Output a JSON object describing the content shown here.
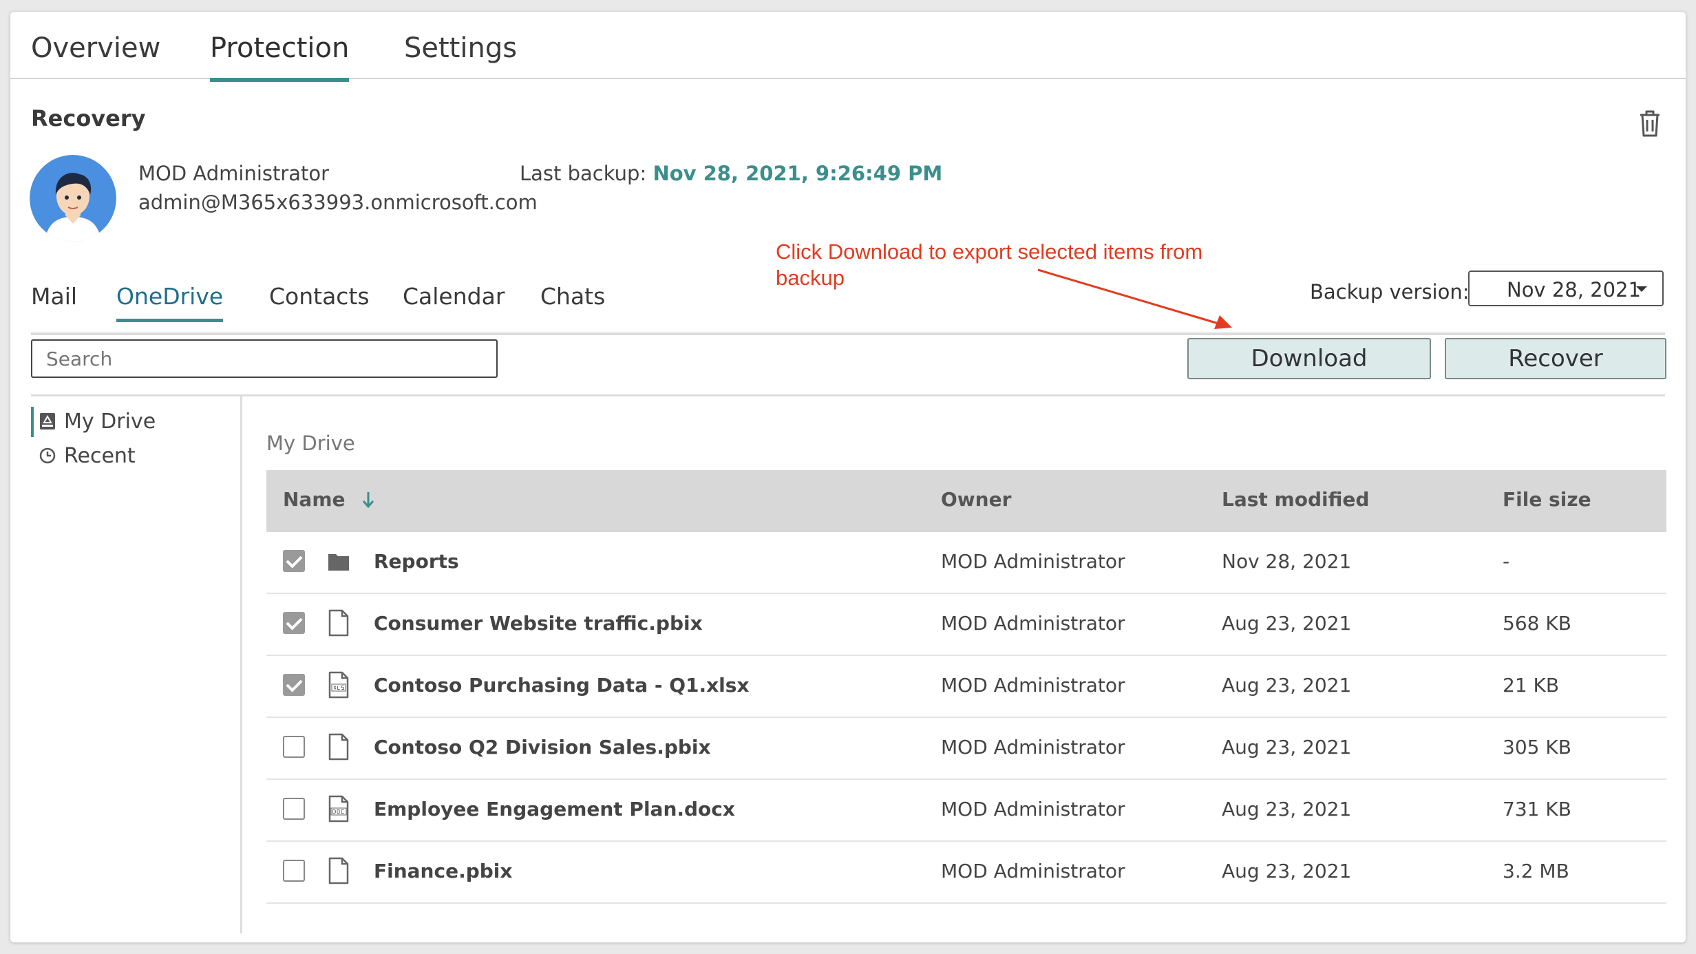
{
  "top_tabs": [
    "Overview",
    "Protection",
    "Settings"
  ],
  "section_title": "Recovery",
  "user": {
    "name": "MOD Administrator",
    "email": "admin@M365x633993.onmicrosoft.com"
  },
  "last_backup": {
    "label": "Last backup:",
    "value": "Nov 28, 2021, 9:26:49 PM"
  },
  "sub_tabs": [
    "Mail",
    "OneDrive",
    "Contacts",
    "Calendar",
    "Chats"
  ],
  "annotation": "Click Download to export selected items from backup",
  "backup_version": {
    "label": "Backup version:",
    "value": "Nov 28, 2021"
  },
  "search": {
    "placeholder": "Search"
  },
  "buttons": {
    "download": "Download",
    "recover": "Recover"
  },
  "sidebar": {
    "items": [
      {
        "label": "My Drive",
        "icon": "drive-icon"
      },
      {
        "label": "Recent",
        "icon": "clock-icon"
      }
    ]
  },
  "breadcrumb": "My Drive",
  "table": {
    "columns": [
      "Name",
      "Owner",
      "Last modified",
      "File size"
    ],
    "rows": [
      {
        "checked": true,
        "icon": "folder-icon",
        "name": "Reports",
        "owner": "MOD Administrator",
        "modified": "Nov 28, 2021",
        "size": "-"
      },
      {
        "checked": true,
        "icon": "file-icon",
        "name": "Consumer Website traffic.pbix",
        "owner": "MOD Administrator",
        "modified": "Aug 23, 2021",
        "size": "568 KB"
      },
      {
        "checked": true,
        "icon": "xls-file-icon",
        "name": "Contoso Purchasing Data - Q1.xlsx",
        "owner": "MOD Administrator",
        "modified": "Aug 23, 2021",
        "size": "21 KB"
      },
      {
        "checked": false,
        "icon": "file-icon",
        "name": "Contoso Q2 Division Sales.pbix",
        "owner": "MOD Administrator",
        "modified": "Aug 23, 2021",
        "size": "305 KB"
      },
      {
        "checked": false,
        "icon": "doc-file-icon",
        "name": "Employee Engagement Plan.docx",
        "owner": "MOD Administrator",
        "modified": "Aug 23, 2021",
        "size": "731 KB"
      },
      {
        "checked": false,
        "icon": "file-icon",
        "name": "Finance.pbix",
        "owner": "MOD Administrator",
        "modified": "Aug 23, 2021",
        "size": "3.2 MB"
      }
    ]
  },
  "colors": {
    "accent": "#3a8f8c",
    "annotation": "#e33b1f",
    "header_bg": "#d8d8d8",
    "button_bg": "#dceaea"
  }
}
